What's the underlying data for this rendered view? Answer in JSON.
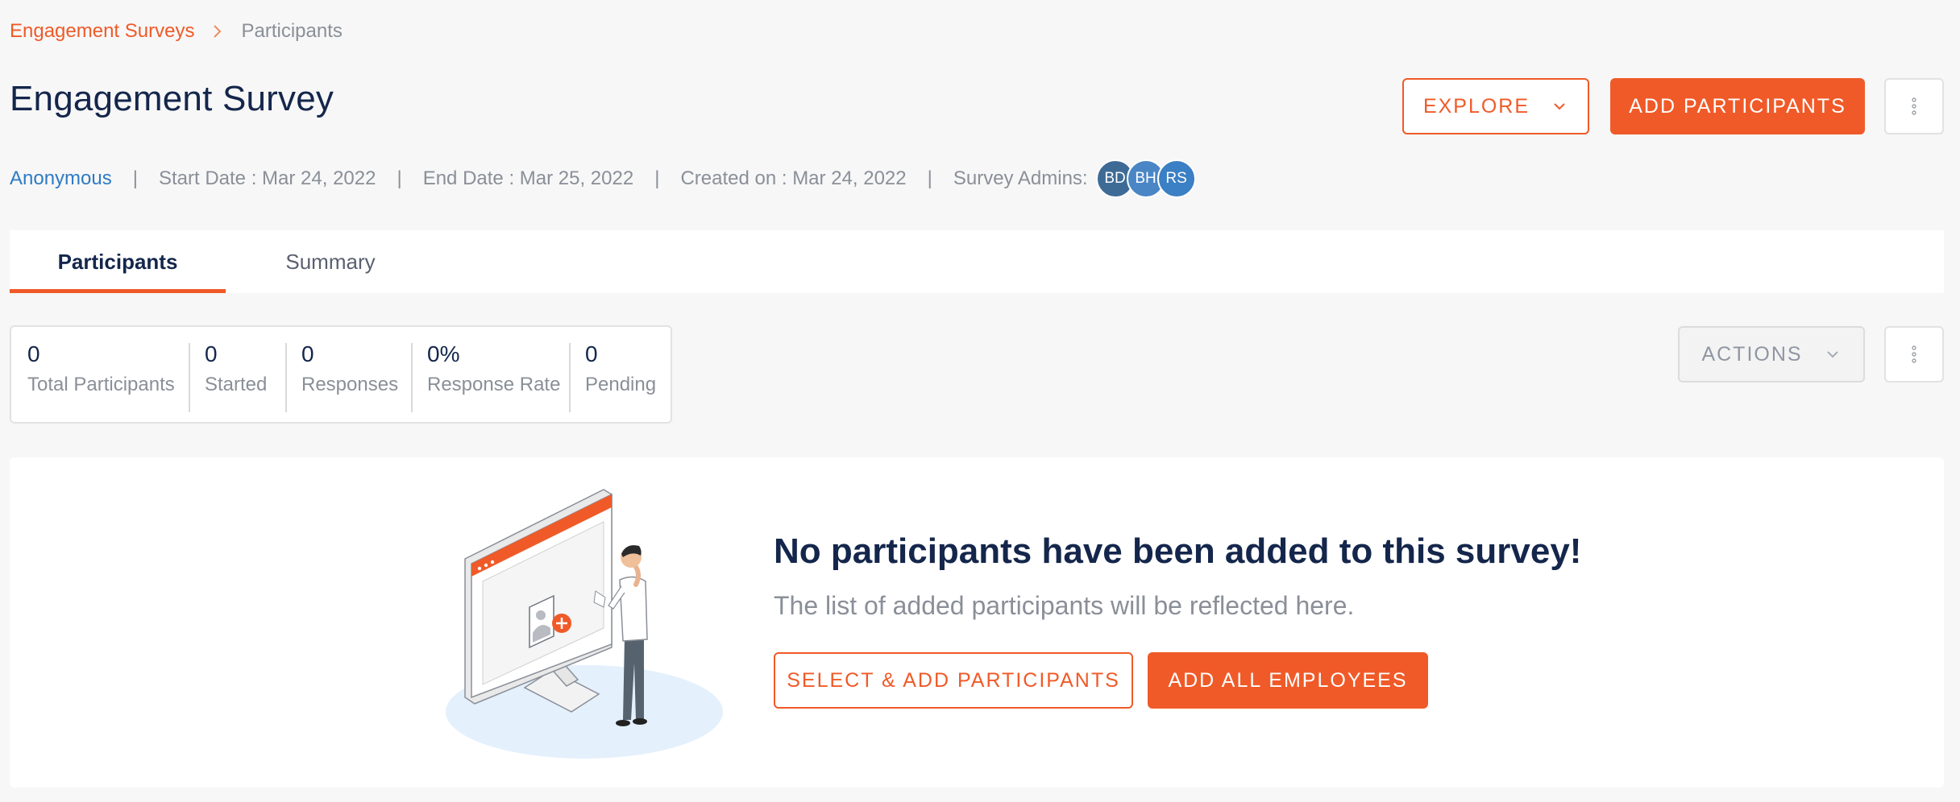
{
  "breadcrumb": {
    "parent": "Engagement Surveys",
    "current": "Participants"
  },
  "page": {
    "title": "Engagement Survey"
  },
  "header_actions": {
    "explore_label": "EXPLORE",
    "add_participants_label": "ADD PARTICIPANTS"
  },
  "meta": {
    "anonymous": "Anonymous",
    "separator": "|",
    "start_date": "Start Date : Mar 24, 2022",
    "end_date": "End Date : Mar 25, 2022",
    "created_on": "Created on : Mar 24, 2022",
    "admins_label": "Survey Admins:",
    "admins": [
      "BD",
      "BH",
      "RS"
    ]
  },
  "tabs": [
    {
      "label": "Participants",
      "active": true
    },
    {
      "label": "Summary",
      "active": false
    }
  ],
  "stats": [
    {
      "value": "0",
      "label": "Total Participants"
    },
    {
      "value": "0",
      "label": "Started"
    },
    {
      "value": "0",
      "label": "Responses"
    },
    {
      "value": "0%",
      "label": "Response Rate"
    },
    {
      "value": "0",
      "label": "Pending"
    }
  ],
  "list_actions": {
    "actions_label": "ACTIONS"
  },
  "empty_state": {
    "title": "No participants have been added to this survey!",
    "subtitle": "The list of added participants will be reflected here.",
    "select_add_label": "SELECT & ADD PARTICIPANTS",
    "add_all_label": "ADD ALL EMPLOYEES"
  },
  "colors": {
    "accent": "#f05a28",
    "title": "#14264b",
    "link": "#2d7bc4",
    "muted": "#8a8f98",
    "background": "#f7f7f7"
  },
  "icons": {
    "breadcrumb_separator": "chevron-right-icon",
    "dropdown": "chevron-down-icon",
    "more": "vertical-dots-icon",
    "illustration": "empty-participants-illustration"
  }
}
